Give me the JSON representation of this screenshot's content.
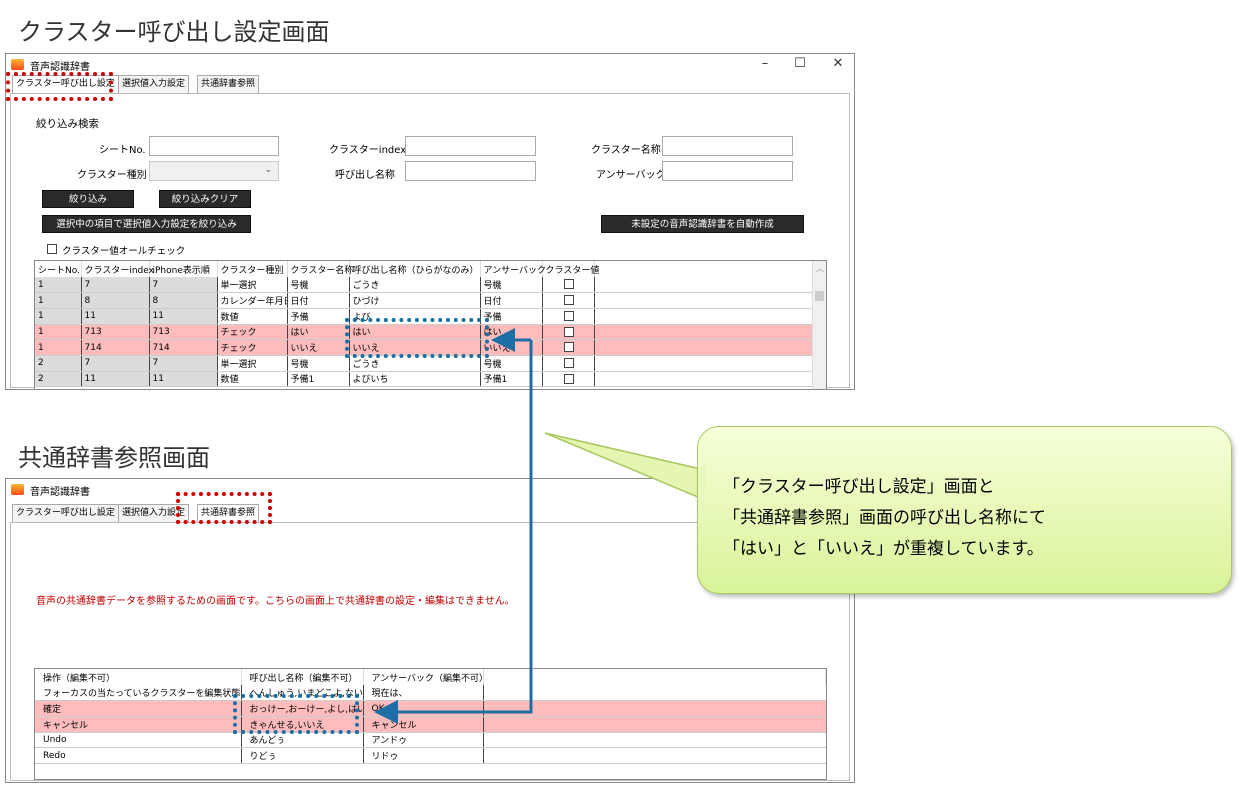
{
  "headings": {
    "top": "クラスター呼び出し設定画面",
    "bottom": "共通辞書参照画面"
  },
  "app": {
    "title": "音声認識辞書",
    "controls": {
      "minimize": "–",
      "maximize": "☐",
      "close": "✕"
    }
  },
  "tabs": [
    "クラスター呼び出し設定",
    "選択値入力設定",
    "共通辞書参照"
  ],
  "filter": {
    "section_title": "絞り込み検索",
    "sheet_no_label": "シートNo.",
    "cluster_index_label": "クラスターindex",
    "cluster_name_label": "クラスター名称",
    "cluster_type_label": "クラスター種別",
    "call_name_label": "呼び出し名称",
    "answerback_label": "アンサーバック",
    "btn_filter": "絞り込み",
    "btn_clear": "絞り込みクリア",
    "btn_filter_selected": "選択中の項目で選択値入力設定を絞り込み",
    "btn_auto_create": "未設定の音声認識辞書を自動作成",
    "check_all_label": "クラスター値オールチェック"
  },
  "cluster_grid": {
    "headers": [
      "シートNo.",
      "クラスターindex",
      "iPhone表示順",
      "クラスター種別",
      "クラスター名称",
      "呼び出し名称（ひらがなのみ）",
      "アンサーバック",
      "クラスター値"
    ],
    "rows": [
      {
        "c": [
          "1",
          "7",
          "7",
          "単一選択",
          "号機",
          "ごうき",
          "号機"
        ],
        "hl": false
      },
      {
        "c": [
          "1",
          "8",
          "8",
          "カレンダー年月日",
          "日付",
          "ひづけ",
          "日付"
        ],
        "hl": false
      },
      {
        "c": [
          "1",
          "11",
          "11",
          "数値",
          "予備",
          "よび",
          "予備"
        ],
        "hl": false
      },
      {
        "c": [
          "1",
          "713",
          "713",
          "チェック",
          "はい",
          "はい",
          "はい"
        ],
        "hl": true
      },
      {
        "c": [
          "1",
          "714",
          "714",
          "チェック",
          "いいえ",
          "いいえ",
          "いいえ"
        ],
        "hl": true
      },
      {
        "c": [
          "2",
          "7",
          "7",
          "単一選択",
          "号機",
          "ごうき",
          "号機"
        ],
        "hl": false
      },
      {
        "c": [
          "2",
          "11",
          "11",
          "数値",
          "予備1",
          "よびいち",
          "予備1"
        ],
        "hl": false
      }
    ]
  },
  "common_dict": {
    "notice": "音声の共通辞書データを参照するための画面です。こちらの画面上で共通辞書の設定・編集はできません。",
    "headers": [
      "操作（編集不可）",
      "呼び出し名称（編集不可）",
      "アンサーバック（編集不可）"
    ],
    "rows": [
      {
        "c": [
          "フォーカスの当たっているクラスターを編集状態にする",
          "へんしゅう,いまどこよ,ない",
          "現在は、"
        ],
        "hl": false
      },
      {
        "c": [
          "確定",
          "おっけー,おーけー,よし,はい",
          "OK"
        ],
        "hl": true
      },
      {
        "c": [
          "キャンセル",
          "きゃんせる,いいえ",
          "キャンセル"
        ],
        "hl": true
      },
      {
        "c": [
          "Undo",
          "あんどぅ",
          "アンドゥ"
        ],
        "hl": false
      },
      {
        "c": [
          "Redo",
          "りどぅ",
          "リドゥ"
        ],
        "hl": false
      }
    ]
  },
  "callout": {
    "line1": "「クラスター呼び出し設定」画面と",
    "line2": "「共通辞書参照」画面の呼び出し名称にて",
    "line3": "「はい」と「いいえ」が重複しています。"
  },
  "colors": {
    "highlight_row": "#ffbcbc",
    "red_marker": "#d00000",
    "blue_marker": "#1c6ea4",
    "callout_fill": "#e3f7b0"
  }
}
